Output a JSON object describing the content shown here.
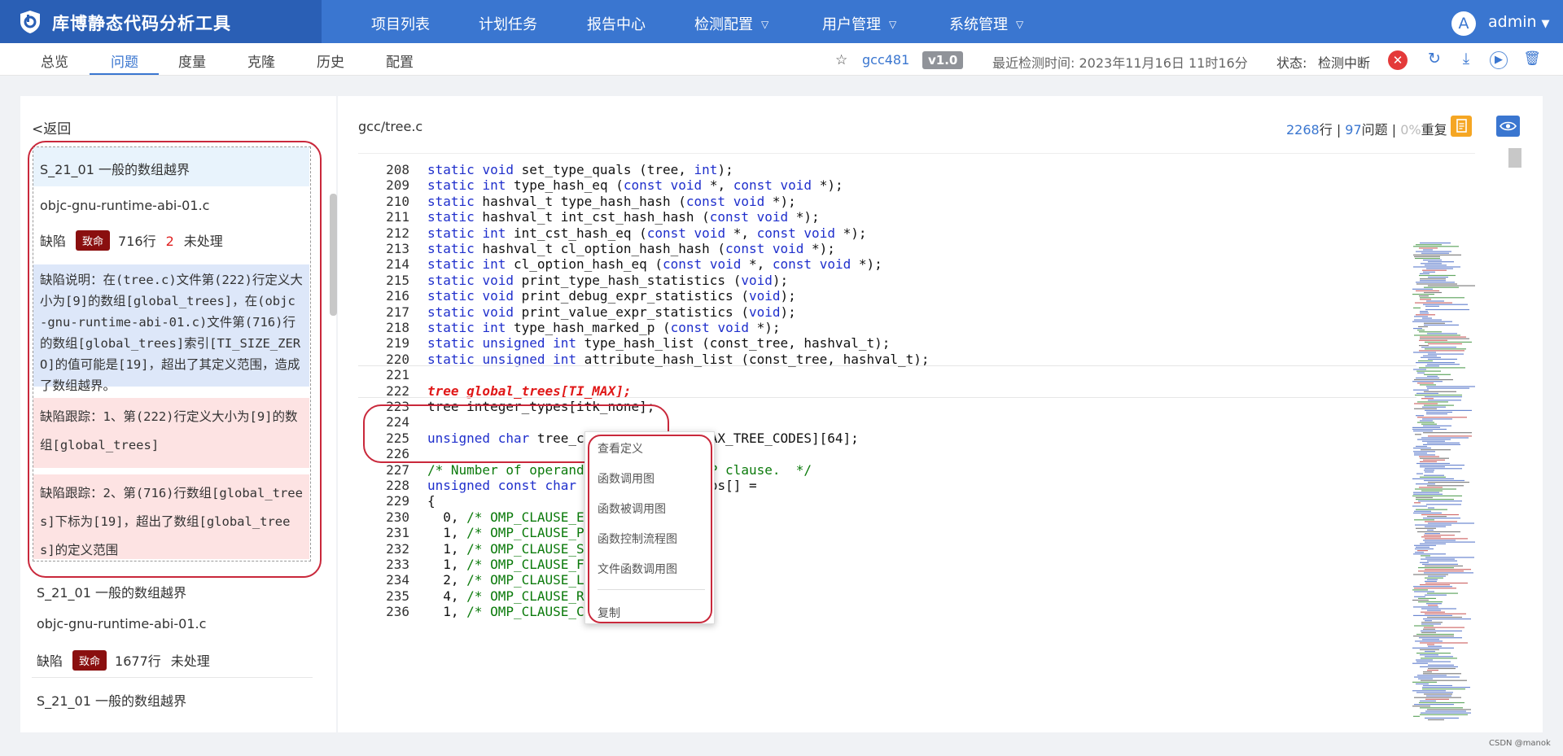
{
  "app": {
    "title": "库博静态代码分析工具"
  },
  "nav": [
    {
      "label": "项目列表",
      "dropdown": false
    },
    {
      "label": "计划任务",
      "dropdown": false
    },
    {
      "label": "报告中心",
      "dropdown": false
    },
    {
      "label": "检测配置",
      "dropdown": true
    },
    {
      "label": "用户管理",
      "dropdown": true
    },
    {
      "label": "系统管理",
      "dropdown": true
    }
  ],
  "user": {
    "avatar_letter": "A",
    "name": "admin"
  },
  "tabs": [
    {
      "label": "总览",
      "active": false
    },
    {
      "label": "问题",
      "active": true
    },
    {
      "label": "度量",
      "active": false
    },
    {
      "label": "克隆",
      "active": false
    },
    {
      "label": "历史",
      "active": false
    },
    {
      "label": "配置",
      "active": false
    }
  ],
  "project": {
    "name": "gcc481",
    "version": "v1.0",
    "last_scan": "最近检测时间: 2023年11月16日 11时16分",
    "status_label": "状态:",
    "status_value": "检测中断"
  },
  "left": {
    "back_label": "返回",
    "selected_issue": {
      "title": "S_21_01 一般的数组越界",
      "file": "objc-gnu-runtime-abi-01.c",
      "type": "缺陷",
      "severity": "致命",
      "line": "716行",
      "count": "2",
      "state": "未处理",
      "description": "缺陷说明：在(tree.c)文件第(222)行定义大小为[9]的数组[global_trees]，在(objc-gnu-runtime-abi-01.c)文件第(716)行的数组[global_trees]索引[TI_SIZE_ZERO]的值可能是[19]，超出了其定义范围，造成了数组越界。",
      "trace1": "缺陷跟踪：1、第(222)行定义大小为[9]的数组[global_trees]",
      "trace2": "缺陷跟踪：2、第(716)行数组[global_trees]下标为[19]，超出了数组[global_trees]的定义范围"
    },
    "issue2": {
      "title": "S_21_01 一般的数组越界",
      "file": "objc-gnu-runtime-abi-01.c",
      "type": "缺陷",
      "severity": "致命",
      "line": "1677行",
      "state": "未处理"
    },
    "issue3": {
      "title": "S_21_01 一般的数组越界"
    }
  },
  "editor": {
    "file_path": "gcc/tree.c",
    "lines_count": "2268",
    "lines_unit": "行",
    "issues_count": "97",
    "issues_unit": "问题",
    "dup_pct": "0%",
    "dup_label": "重复"
  },
  "code": [
    {
      "n": "208",
      "t": "static void set_type_quals (tree, int);"
    },
    {
      "n": "209",
      "t": "static int type_hash_eq (const void *, const void *);"
    },
    {
      "n": "210",
      "t": "static hashval_t type_hash_hash (const void *);"
    },
    {
      "n": "211",
      "t": "static hashval_t int_cst_hash_hash (const void *);"
    },
    {
      "n": "212",
      "t": "static int int_cst_hash_eq (const void *, const void *);"
    },
    {
      "n": "213",
      "t": "static hashval_t cl_option_hash_hash (const void *);"
    },
    {
      "n": "214",
      "t": "static int cl_option_hash_eq (const void *, const void *);"
    },
    {
      "n": "215",
      "t": "static void print_type_hash_statistics (void);"
    },
    {
      "n": "216",
      "t": "static void print_debug_expr_statistics (void);"
    },
    {
      "n": "217",
      "t": "static void print_value_expr_statistics (void);"
    },
    {
      "n": "218",
      "t": "static int type_hash_marked_p (const void *);"
    },
    {
      "n": "219",
      "t": "static unsigned int type_hash_list (const_tree, hashval_t);"
    },
    {
      "n": "220",
      "t": "static unsigned int attribute_hash_list (const_tree, hashval_t);"
    },
    {
      "n": "221",
      "t": ""
    },
    {
      "n": "222",
      "t": "tree global_trees[TI_MAX];"
    },
    {
      "n": "223",
      "t": "tree integer_types[itk_none];"
    },
    {
      "n": "224",
      "t": ""
    },
    {
      "n": "225",
      "t": "unsigned char tree_contains_struct[MAX_TREE_CODES][64];"
    },
    {
      "n": "226",
      "t": ""
    },
    {
      "n": "227",
      "t": "/* Number of operands for each OpenMP clause.  */"
    },
    {
      "n": "228",
      "t": "unsigned const char omp_clause_num_ops[] ="
    },
    {
      "n": "229",
      "t": "{"
    },
    {
      "n": "230",
      "t": "  0, /* OMP_CLAUSE_ERROR  */"
    },
    {
      "n": "231",
      "t": "  1, /* OMP_CLAUSE_PRIVATE  */"
    },
    {
      "n": "232",
      "t": "  1, /* OMP_CLAUSE_SHARED  */"
    },
    {
      "n": "233",
      "t": "  1, /* OMP_CLAUSE_FIRSTPRIVATE  */"
    },
    {
      "n": "234",
      "t": "  2, /* OMP_CLAUSE_LASTPRIVATE  */"
    },
    {
      "n": "235",
      "t": "  4, /* OMP_CLAUSE_REDUCTION  */"
    },
    {
      "n": "236",
      "t": "  1, /* OMP_CLAUSE_COPYIN  */"
    }
  ],
  "context_menu": [
    "查看定义",
    "函数调用图",
    "函数被调用图",
    "函数控制流程图",
    "文件函数调用图",
    "复制"
  ],
  "watermark": "CSDN @manok"
}
